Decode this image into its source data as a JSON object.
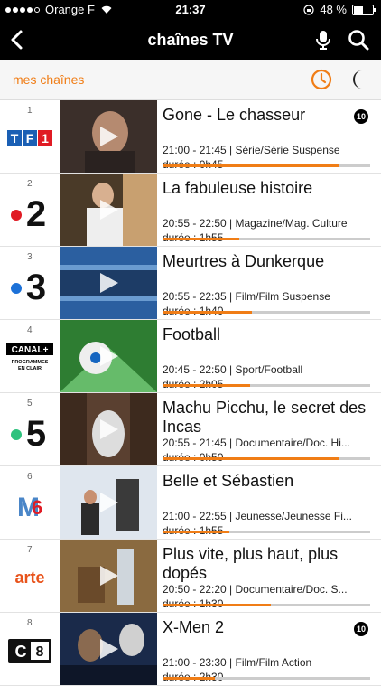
{
  "status": {
    "carrier": "Orange F",
    "time": "21:37",
    "battery": "48 %"
  },
  "nav": {
    "title": "chaînes TV"
  },
  "filter": {
    "label": "mes chaînes"
  },
  "colors": {
    "accent": "#f07d16",
    "bar_bg": "#000000"
  },
  "channels": [
    {
      "number": "1",
      "logo": "TF1",
      "title": "Gone - Le chasseur",
      "time": "21:00 - 21:45 | Série/Série Suspense",
      "duration": "durée : 0h45",
      "progress": 0.85,
      "rating": "10"
    },
    {
      "number": "2",
      "logo": "France 2",
      "title": "La fabuleuse histoire",
      "time": "20:55 - 22:50 | Magazine/Mag. Culture",
      "duration": "durée : 1h55",
      "progress": 0.37
    },
    {
      "number": "3",
      "logo": "France 3",
      "title": "Meurtres à Dunkerque",
      "time": "20:55 - 22:35 | Film/Film Suspense",
      "duration": "durée : 1h40",
      "progress": 0.43
    },
    {
      "number": "4",
      "logo": "CANAL+",
      "logo_sub": "PROGRAMMES EN CLAIR",
      "title": "Football",
      "time": "20:45 - 22:50 | Sport/Football",
      "duration": "durée : 2h05",
      "progress": 0.42
    },
    {
      "number": "5",
      "logo": "France 5",
      "title": "Machu Picchu, le secret des Incas",
      "time": "20:55 - 21:45 | Documentaire/Doc. Hi...",
      "duration": "durée : 0h50",
      "progress": 0.85
    },
    {
      "number": "6",
      "logo": "M6",
      "title": "Belle et Sébastien",
      "time": "21:00 - 22:55 | Jeunesse/Jeunesse Fi...",
      "duration": "durée : 1h55",
      "progress": 0.32
    },
    {
      "number": "7",
      "logo": "arte",
      "title": "Plus vite, plus haut, plus dopés",
      "time": "20:50 - 22:20 | Documentaire/Doc. S...",
      "duration": "durée : 1h30",
      "progress": 0.52
    },
    {
      "number": "8",
      "logo": "C8",
      "title": "X-Men 2",
      "time": "21:00 - 23:30 | Film/Film Action",
      "duration": "durée : 2h30",
      "progress": 0.25,
      "rating": "10"
    }
  ]
}
